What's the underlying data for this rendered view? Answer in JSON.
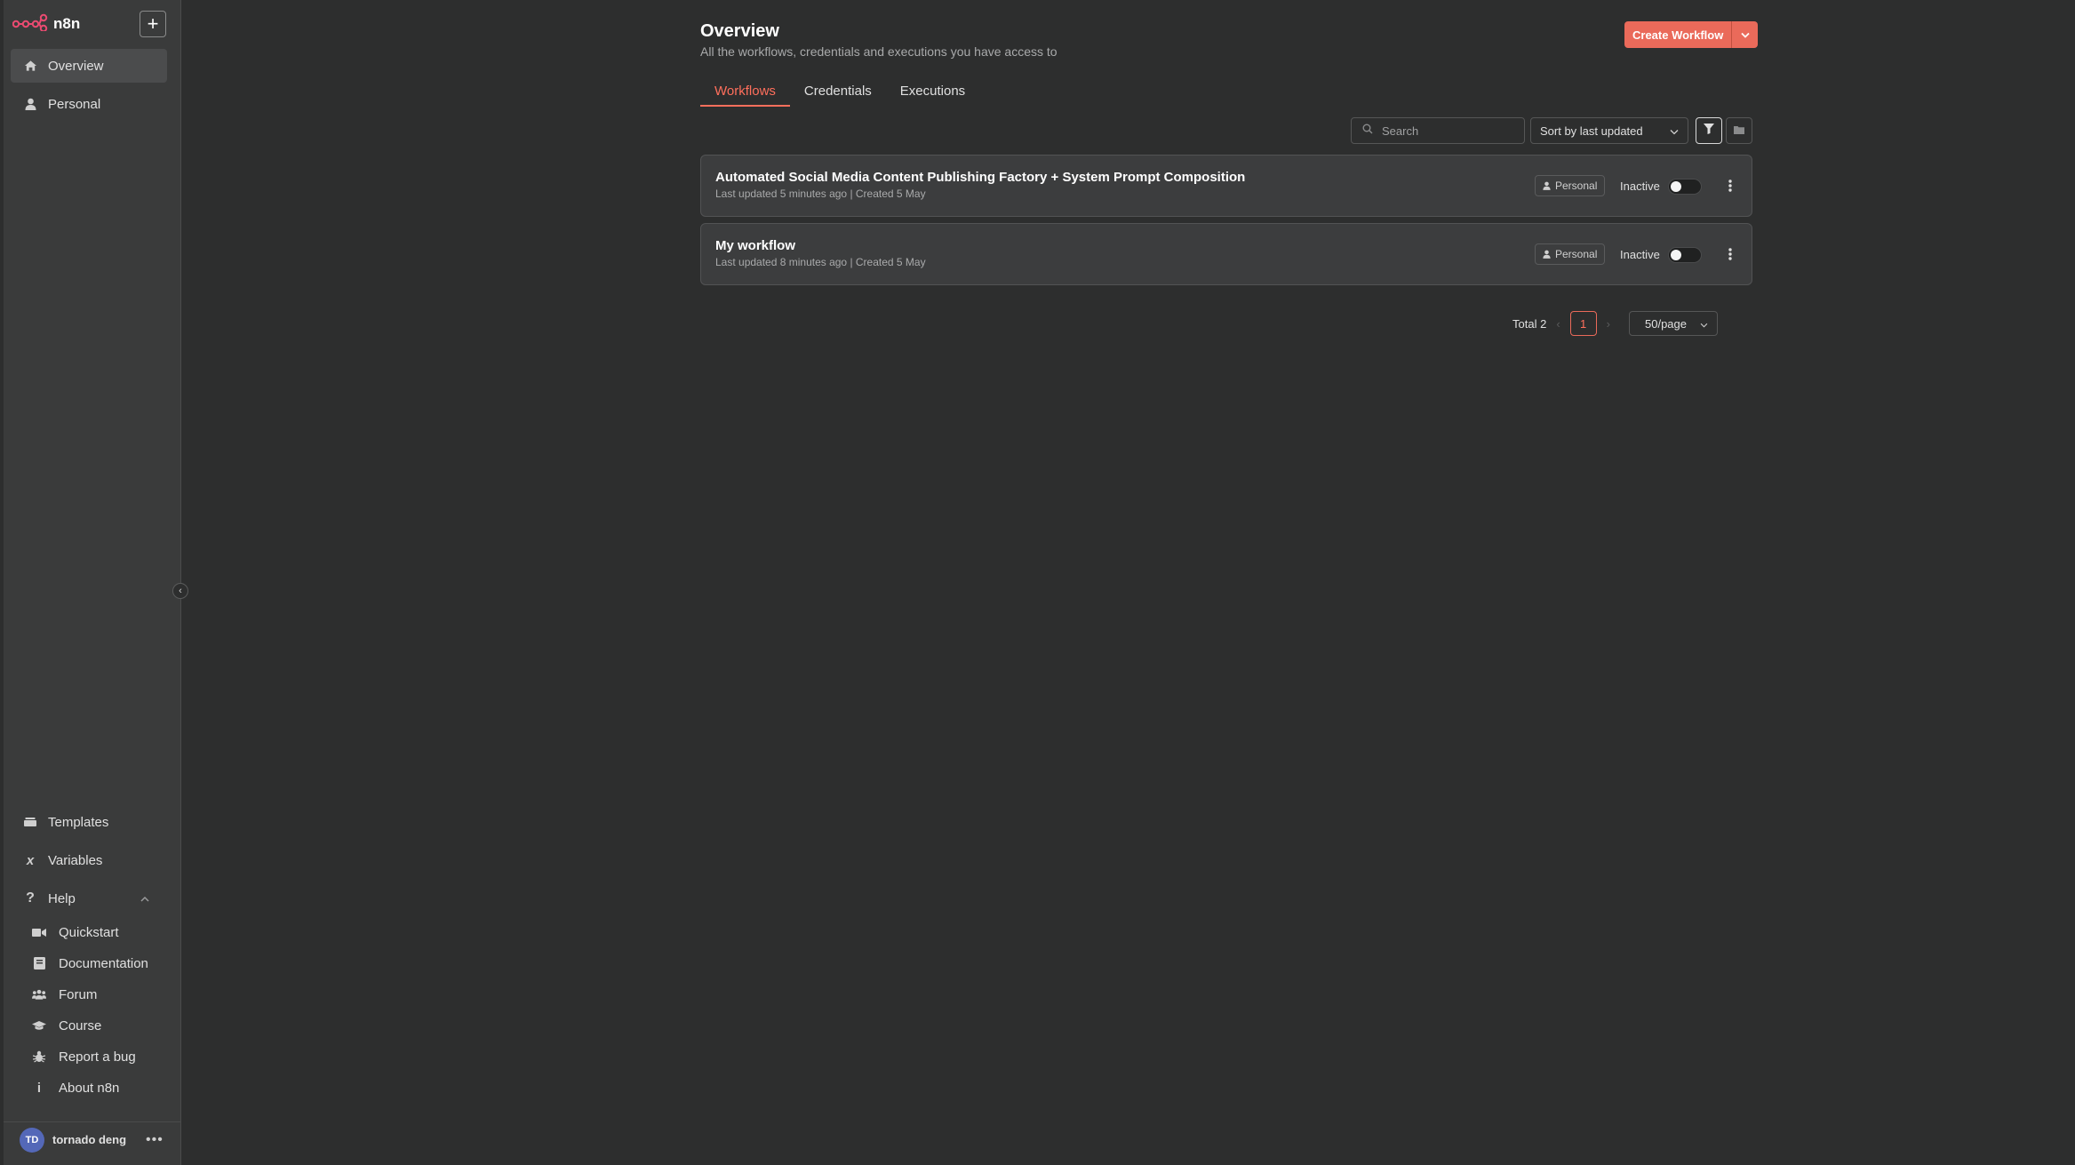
{
  "sidebar": {
    "logo_text": "n8n",
    "top_items": [
      {
        "label": "Overview",
        "icon": "home-icon",
        "active": true
      },
      {
        "label": "Personal",
        "icon": "user-icon",
        "active": false
      }
    ],
    "bottom_items": [
      {
        "label": "Templates",
        "icon": "templates-icon"
      },
      {
        "label": "Variables",
        "icon": "variables-icon"
      },
      {
        "label": "Help",
        "icon": "help-icon"
      }
    ],
    "help_items": [
      {
        "label": "Quickstart",
        "icon": "video-icon"
      },
      {
        "label": "Documentation",
        "icon": "book-icon"
      },
      {
        "label": "Forum",
        "icon": "users-icon"
      },
      {
        "label": "Course",
        "icon": "graduation-cap-icon"
      },
      {
        "label": "Report a bug",
        "icon": "bug-icon"
      },
      {
        "label": "About n8n",
        "icon": "info-icon"
      }
    ],
    "user": {
      "initials": "TD",
      "name": "tornado deng"
    }
  },
  "header": {
    "title": "Overview",
    "subtitle": "All the workflows, credentials and executions you have access to",
    "create_label": "Create Workflow"
  },
  "tabs": [
    {
      "label": "Workflows",
      "active": true
    },
    {
      "label": "Credentials",
      "active": false
    },
    {
      "label": "Executions",
      "active": false
    }
  ],
  "toolbar": {
    "search_placeholder": "Search",
    "sort_value": "Sort by last updated"
  },
  "workflows": [
    {
      "name": "Automated Social Media Content Publishing Factory + System Prompt Composition",
      "meta": "Last updated 5 minutes ago | Created 5 May",
      "owner": "Personal",
      "status": "Inactive",
      "active": false
    },
    {
      "name": "My workflow",
      "meta": "Last updated 8 minutes ago | Created 5 May",
      "owner": "Personal",
      "status": "Inactive",
      "active": false
    }
  ],
  "pagination": {
    "total": "Total 2",
    "current_page": "1",
    "per_page": "50/page"
  },
  "colors": {
    "accent": "#ea6a5a",
    "background": "#2d2e2e",
    "sidebar": "#3a3b3b"
  }
}
